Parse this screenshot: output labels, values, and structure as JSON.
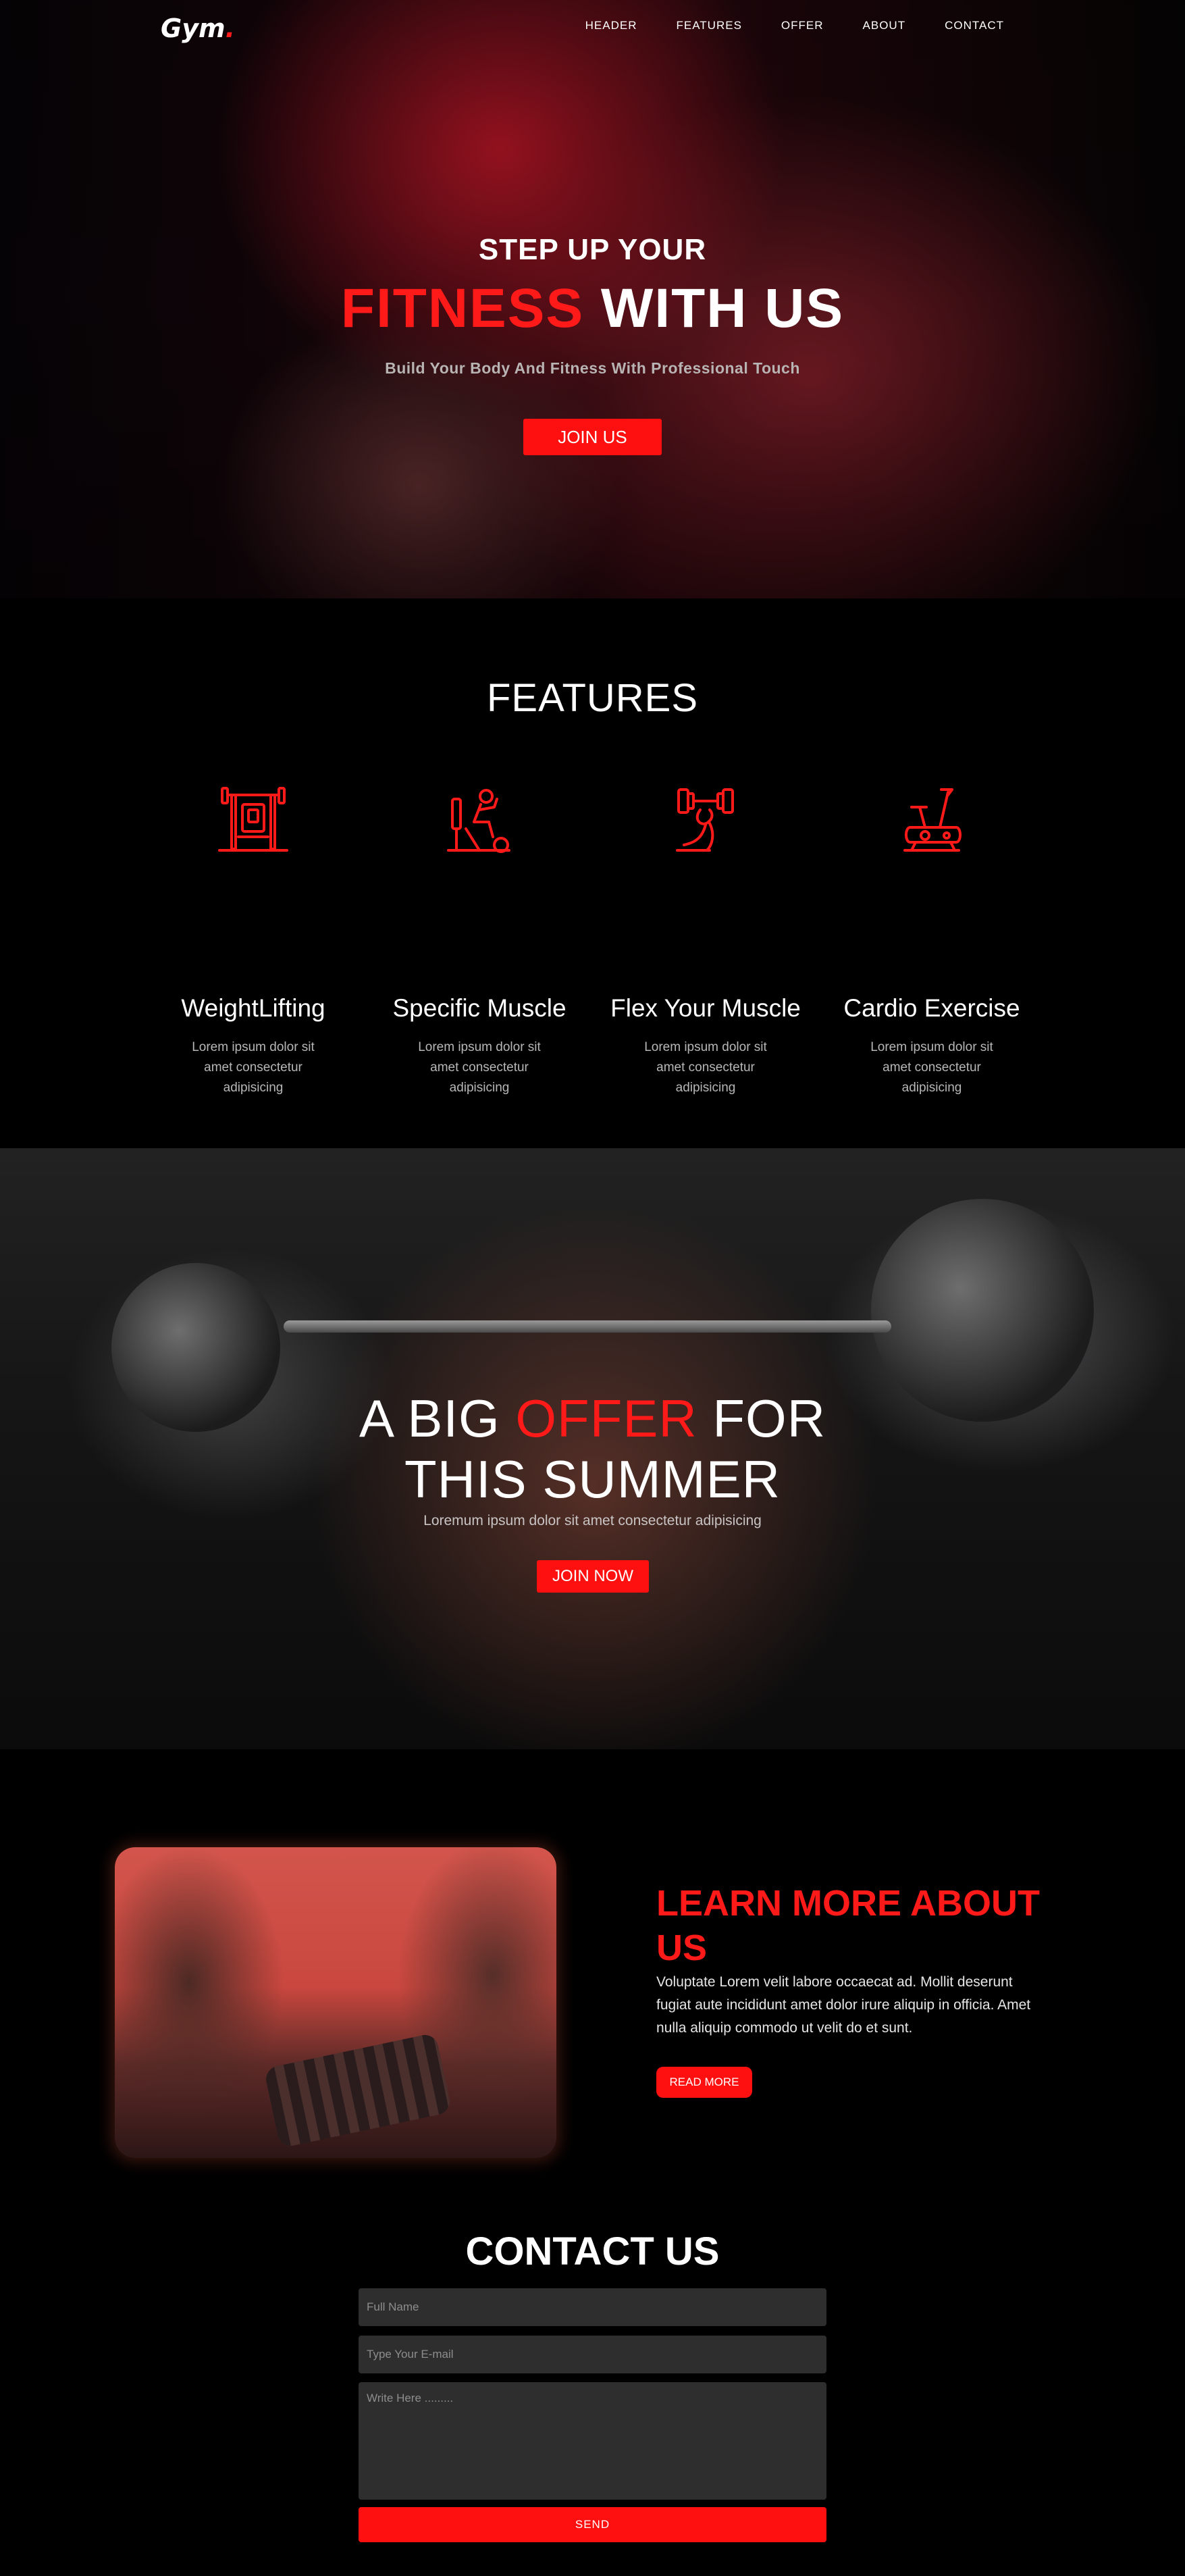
{
  "nav": {
    "logo_text": "Gym",
    "logo_dot": ".",
    "items": [
      "HEADER",
      "FEATURES",
      "OFFER",
      "ABOUT",
      "CONTACT"
    ]
  },
  "hero": {
    "subtitle": "STEP UP YOUR",
    "title_highlight": "FITNESS",
    "title_rest": " WITH US",
    "tagline": "Build Your Body And Fitness With Professional Touch",
    "button": "JOIN US"
  },
  "features": {
    "title": "FEATURES",
    "items": [
      {
        "title": "WeightLifting",
        "text": "Lorem ipsum dolor sit amet consectetur adipisicing",
        "icon": "weight-bench-icon"
      },
      {
        "title": "Specific Muscle",
        "text": "Lorem ipsum dolor sit amet consectetur adipisicing",
        "icon": "exercise-machine-icon"
      },
      {
        "title": "Flex Your Muscle",
        "text": "Lorem ipsum dolor sit amet consectetur adipisicing",
        "icon": "flex-dumbbell-icon"
      },
      {
        "title": "Cardio Exercise",
        "text": "Lorem ipsum dolor sit amet consectetur adipisicing",
        "icon": "exercise-bike-icon"
      }
    ]
  },
  "offer": {
    "title_part1": "A BIG ",
    "title_highlight": "OFFER",
    "title_part2": " FOR",
    "title_line2": "THIS SUMMER",
    "description": "Loremum ipsum dolor sit amet consectetur adipisicing",
    "button": "JOIN NOW"
  },
  "about": {
    "title": "LEARN MORE ABOUT US",
    "text": "Voluptate Lorem velit labore occaecat ad. Mollit deserunt fugiat aute incididunt amet dolor irure aliquip in officia. Amet nulla aliquip commodo ut velit do et sunt.",
    "button": "READ MORE"
  },
  "contact": {
    "title": "CONTACT US",
    "name_placeholder": "Full Name",
    "email_placeholder": "Type Your E-mail",
    "message_placeholder": "Write Here .........",
    "button": "SEND"
  },
  "colors": {
    "accent": "#ff1010",
    "background": "#000000",
    "field_bg": "#2e2e2e"
  }
}
